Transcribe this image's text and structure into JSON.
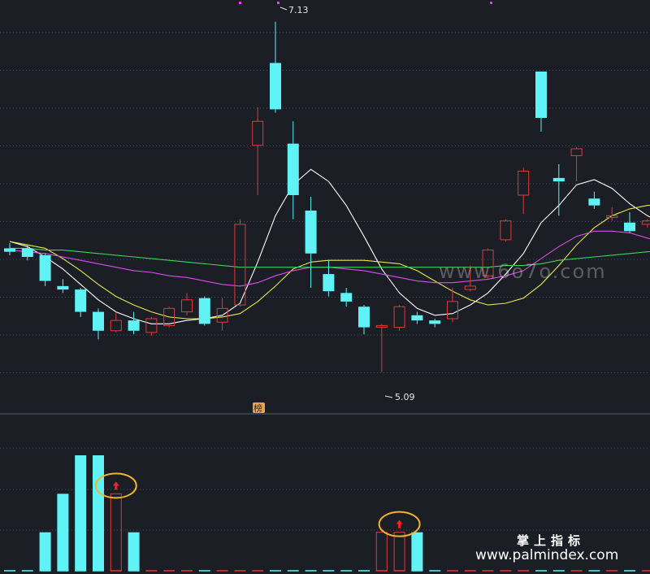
{
  "colors": {
    "background": "#1b1e25",
    "grid": "#4a5060",
    "up": "#e0393b",
    "down": "#5ff3f8",
    "ma_white": "#ffffff",
    "ma_yellow": "#e8e84a",
    "ma_magenta": "#d84ee8",
    "ma_green": "#3ed35a",
    "marker": "#f0b429",
    "arrow": "#ff2020"
  },
  "annotations": {
    "high_label": "7.13",
    "low_label": "5.09",
    "badge": "榜"
  },
  "watermark": {
    "faint": "www.6o7o.com",
    "url": "www.palmindex.com",
    "brand": "掌上指标"
  },
  "chart_data": {
    "type": "candlestick",
    "ylim": [
      4.95,
      7.2
    ],
    "high": 7.13,
    "low": 5.09,
    "candles": [
      {
        "o": 5.81,
        "c": 5.79,
        "h": 5.84,
        "l": 5.77
      },
      {
        "o": 5.81,
        "c": 5.76,
        "h": 5.83,
        "l": 5.74
      },
      {
        "o": 5.77,
        "c": 5.62,
        "h": 5.78,
        "l": 5.59
      },
      {
        "o": 5.59,
        "c": 5.57,
        "h": 5.63,
        "l": 5.55
      },
      {
        "o": 5.57,
        "c": 5.44,
        "h": 5.58,
        "l": 5.41
      },
      {
        "o": 5.44,
        "c": 5.33,
        "h": 5.46,
        "l": 5.28
      },
      {
        "o": 5.33,
        "c": 5.39,
        "h": 5.44,
        "l": 5.32
      },
      {
        "o": 5.39,
        "c": 5.33,
        "h": 5.44,
        "l": 5.31
      },
      {
        "o": 5.32,
        "c": 5.4,
        "h": 5.41,
        "l": 5.3
      },
      {
        "o": 5.36,
        "c": 5.46,
        "h": 5.47,
        "l": 5.35
      },
      {
        "o": 5.44,
        "c": 5.51,
        "h": 5.55,
        "l": 5.42
      },
      {
        "o": 5.52,
        "c": 5.37,
        "h": 5.53,
        "l": 5.36
      },
      {
        "o": 5.38,
        "c": 5.46,
        "h": 5.52,
        "l": 5.33
      },
      {
        "o": 5.48,
        "c": 5.95,
        "h": 5.98,
        "l": 5.47
      },
      {
        "o": 6.41,
        "c": 6.55,
        "h": 6.63,
        "l": 6.12
      },
      {
        "o": 6.89,
        "c": 6.62,
        "h": 7.13,
        "l": 6.6
      },
      {
        "o": 6.42,
        "c": 6.12,
        "h": 6.55,
        "l": 5.98
      },
      {
        "o": 6.03,
        "c": 5.78,
        "h": 6.11,
        "l": 5.58
      },
      {
        "o": 5.66,
        "c": 5.56,
        "h": 5.74,
        "l": 5.53
      },
      {
        "o": 5.55,
        "c": 5.5,
        "h": 5.58,
        "l": 5.47
      },
      {
        "o": 5.47,
        "c": 5.35,
        "h": 5.48,
        "l": 5.31
      },
      {
        "o": 5.35,
        "c": 5.36,
        "h": 5.37,
        "l": 5.09
      },
      {
        "o": 5.35,
        "c": 5.47,
        "h": 5.48,
        "l": 5.33
      },
      {
        "o": 5.42,
        "c": 5.39,
        "h": 5.44,
        "l": 5.37
      },
      {
        "o": 5.39,
        "c": 5.37,
        "h": 5.4,
        "l": 5.35
      },
      {
        "o": 5.4,
        "c": 5.5,
        "h": 5.58,
        "l": 5.38
      },
      {
        "o": 5.57,
        "c": 5.59,
        "h": 5.71,
        "l": 5.56
      },
      {
        "o": 5.65,
        "c": 5.8,
        "h": 5.81,
        "l": 5.63
      },
      {
        "o": 5.86,
        "c": 5.97,
        "h": 5.98,
        "l": 5.85
      },
      {
        "o": 6.12,
        "c": 6.26,
        "h": 6.28,
        "l": 6.01
      },
      {
        "o": 6.84,
        "c": 6.57,
        "h": 6.6,
        "l": 6.49
      },
      {
        "o": 6.22,
        "c": 6.2,
        "h": 6.3,
        "l": 6.0
      },
      {
        "o": 6.35,
        "c": 6.39,
        "h": 6.4,
        "l": 6.2
      },
      {
        "o": 6.1,
        "c": 6.06,
        "h": 6.14,
        "l": 6.04
      },
      {
        "o": 5.99,
        "c": 6.0,
        "h": 6.05,
        "l": 5.97
      },
      {
        "o": 5.96,
        "c": 5.91,
        "h": 6.02,
        "l": 5.9
      },
      {
        "o": 5.95,
        "c": 5.97,
        "h": 5.98,
        "l": 5.93
      },
      {
        "o": 5.92,
        "c": 5.9,
        "h": 5.95,
        "l": 5.88
      }
    ],
    "ma_lines": [
      {
        "color": "ma_white",
        "values": [
          5.85,
          5.82,
          5.76,
          5.69,
          5.6,
          5.51,
          5.44,
          5.4,
          5.37,
          5.37,
          5.39,
          5.4,
          5.42,
          5.49,
          5.73,
          6.0,
          6.18,
          6.27,
          6.2,
          6.06,
          5.88,
          5.69,
          5.55,
          5.46,
          5.42,
          5.43,
          5.48,
          5.55,
          5.66,
          5.78,
          5.96,
          6.06,
          6.18,
          6.21,
          6.16,
          6.07,
          6.0,
          5.95
        ]
      },
      {
        "color": "ma_yellow",
        "values": [
          5.85,
          5.83,
          5.81,
          5.75,
          5.68,
          5.6,
          5.53,
          5.48,
          5.44,
          5.41,
          5.4,
          5.4,
          5.41,
          5.43,
          5.5,
          5.59,
          5.69,
          5.73,
          5.74,
          5.74,
          5.74,
          5.73,
          5.72,
          5.68,
          5.62,
          5.56,
          5.51,
          5.48,
          5.49,
          5.52,
          5.6,
          5.71,
          5.83,
          5.93,
          6.0,
          6.04,
          6.06,
          6.07
        ]
      },
      {
        "color": "ma_magenta",
        "values": [
          5.8,
          5.79,
          5.78,
          5.76,
          5.74,
          5.72,
          5.7,
          5.68,
          5.67,
          5.65,
          5.64,
          5.62,
          5.6,
          5.59,
          5.61,
          5.65,
          5.68,
          5.7,
          5.7,
          5.69,
          5.68,
          5.66,
          5.64,
          5.62,
          5.61,
          5.61,
          5.62,
          5.63,
          5.65,
          5.68,
          5.75,
          5.82,
          5.88,
          5.91,
          5.91,
          5.9,
          5.87,
          5.84
        ]
      },
      {
        "color": "ma_green",
        "values": [
          5.81,
          5.81,
          5.8,
          5.8,
          5.79,
          5.78,
          5.77,
          5.76,
          5.75,
          5.74,
          5.73,
          5.72,
          5.71,
          5.7,
          5.7,
          5.7,
          5.7,
          5.7,
          5.7,
          5.7,
          5.7,
          5.7,
          5.7,
          5.7,
          5.7,
          5.7,
          5.7,
          5.7,
          5.71,
          5.71,
          5.72,
          5.74,
          5.75,
          5.76,
          5.77,
          5.78,
          5.79,
          5.8
        ]
      }
    ],
    "volume": {
      "ylim": [
        0,
        3
      ],
      "bars": [
        {
          "index": 2,
          "value": 1,
          "dir": "down"
        },
        {
          "index": 3,
          "value": 2,
          "dir": "down"
        },
        {
          "index": 4,
          "value": 3,
          "dir": "down"
        },
        {
          "index": 5,
          "value": 3,
          "dir": "down"
        },
        {
          "index": 6,
          "value": 2,
          "dir": "up",
          "marker": true
        },
        {
          "index": 7,
          "value": 1,
          "dir": "down"
        },
        {
          "index": 21,
          "value": 1,
          "dir": "up"
        },
        {
          "index": 22,
          "value": 1,
          "dir": "up",
          "marker": true
        },
        {
          "index": 23,
          "value": 1,
          "dir": "down"
        }
      ]
    }
  }
}
